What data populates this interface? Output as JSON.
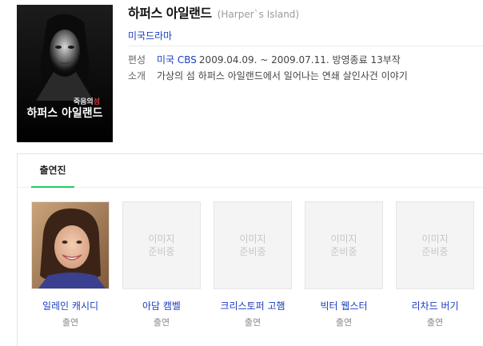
{
  "show": {
    "title": "하퍼스 아일랜드",
    "title_en": "(Harper`s Island)",
    "genre": "미국드라마",
    "poster": {
      "tagline_part1": "죽음의",
      "tagline_part2": "섬",
      "logo_text": "하퍼스 아일랜드"
    },
    "broadcast": {
      "label": "편성",
      "network": "미국 CBS",
      "period": "2009.04.09. ~ 2009.07.11. 방영종료 13부작"
    },
    "summary": {
      "label": "소개",
      "text": "가상의 섬 하퍼스 아일랜드에서 일어나는 연쇄 살인사건 이야기"
    }
  },
  "cast_section": {
    "tab_label": "출연진",
    "placeholder_line1": "이미지",
    "placeholder_line2": "준비중",
    "members": [
      {
        "name": "일레인 캐시디",
        "role": "출연",
        "has_photo": true
      },
      {
        "name": "아담 캠벨",
        "role": "출연",
        "has_photo": false
      },
      {
        "name": "크리스토퍼 고햄",
        "role": "출연",
        "has_photo": false
      },
      {
        "name": "빅터 웹스터",
        "role": "출연",
        "has_photo": false
      },
      {
        "name": "리차드 버기",
        "role": "출연",
        "has_photo": false
      }
    ]
  },
  "colors": {
    "link": "#1a3dc1",
    "tab_underline": "#19ce60",
    "placeholder_bg": "#f4f4f4",
    "placeholder_text": "#c6c6c6"
  }
}
